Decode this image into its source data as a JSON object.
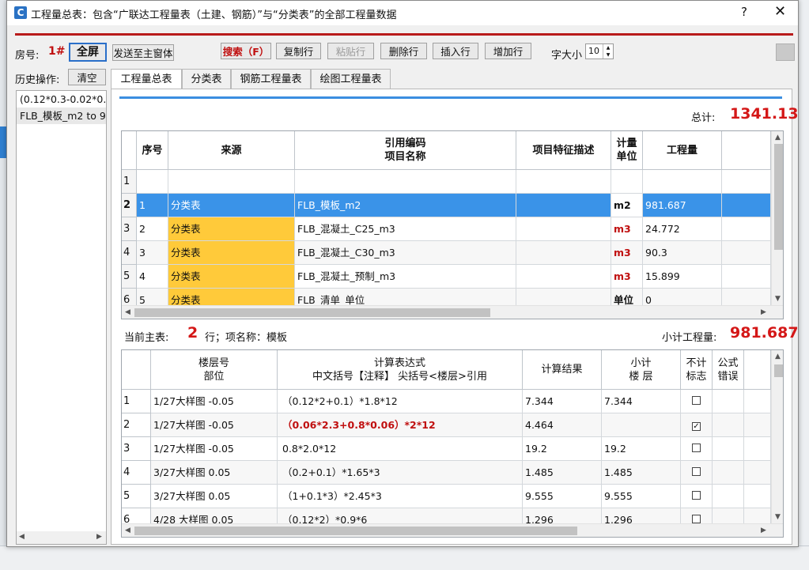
{
  "window": {
    "title": "工程量总表：包含“广联达工程量表（土建、钢筋）”与“分类表”的全部工程量数据",
    "icon": "C",
    "help": "?",
    "close": "✕"
  },
  "toolbar": {
    "room_label": "房号:",
    "room_value": "1#",
    "full_label": "全屏",
    "send_label": "发送至主窗体",
    "search_label": "搜索（F）",
    "copy_row": "复制行",
    "paste_row": "粘贴行",
    "delete_row": "删除行",
    "insert_row": "插入行",
    "add_row": "增加行",
    "font_size_label": "字大小",
    "font_size_value": "10"
  },
  "history": {
    "label": "历史操作:",
    "clear_label": "清空",
    "items": [
      "(0.12*0.3-0.02*0.",
      "FLB_模板_m2 to 9"
    ]
  },
  "tabs": [
    "工程量总表",
    "分类表",
    "钢筋工程量表",
    "绘图工程量表"
  ],
  "summary": {
    "total_label": "总计:",
    "total_value": "1341.13"
  },
  "main_table": {
    "headers": {
      "seq": "序号",
      "source": "来源",
      "code_line1": "引用编码",
      "code_line2": "项目名称",
      "desc": "项目特征描述",
      "unit_line1": "计量",
      "unit_line2": "单位",
      "qty": "工程量"
    },
    "rows": [
      {
        "row": "1",
        "seq": "",
        "source": "",
        "name": "",
        "desc": "",
        "unit": "",
        "qty": ""
      },
      {
        "row": "2",
        "seq": "1",
        "source": "分类表",
        "name": "FLB_模板_m2",
        "desc": "",
        "unit": "m2",
        "qty": "981.687"
      },
      {
        "row": "3",
        "seq": "2",
        "source": "分类表",
        "name": "FLB_混凝土_C25_m3",
        "desc": "",
        "unit": "m3",
        "qty": "24.772"
      },
      {
        "row": "4",
        "seq": "3",
        "source": "分类表",
        "name": "FLB_混凝土_C30_m3",
        "desc": "",
        "unit": "m3",
        "qty": "90.3"
      },
      {
        "row": "5",
        "seq": "4",
        "source": "分类表",
        "name": "FLB_混凝土_预制_m3",
        "desc": "",
        "unit": "m3",
        "qty": "15.899"
      },
      {
        "row": "6",
        "seq": "5",
        "source": "分类表",
        "name": "FLB_清单_单位",
        "desc": "",
        "unit": "单位",
        "qty": "0"
      }
    ]
  },
  "current": {
    "label": "当前主表:",
    "number": "2",
    "name_text": "行；项名称：模板",
    "subtotal_label": "小计工程量:",
    "subtotal_value": "981.687"
  },
  "detail_table": {
    "headers": {
      "floor_line1": "楼层号",
      "floor_line2": "部位",
      "expr_line1": "计算表达式",
      "expr_line2": "中文括号【注释】   尖括号<楼层>引用",
      "result": "计算结果",
      "subtotal_line1": "小计",
      "subtotal_line2": "楼 层",
      "exclude_line1": "不计",
      "exclude_line2": "标志",
      "error_line1": "公式",
      "error_line2": "错误"
    },
    "rows": [
      {
        "row": "1",
        "floor": "1/27大样图 -0.05",
        "expr": "（0.12*2+0.1）*1.8*12",
        "result": "7.344",
        "subtotal": "7.344",
        "excluded": false,
        "highlight": false
      },
      {
        "row": "2",
        "floor": "1/27大样图 -0.05",
        "expr": "（0.06*2.3+0.8*0.06）*2*12",
        "result": "4.464",
        "subtotal": "",
        "excluded": true,
        "highlight": true
      },
      {
        "row": "3",
        "floor": "1/27大样图 -0.05",
        "expr": "0.8*2.0*12",
        "result": "19.2",
        "subtotal": "19.2",
        "excluded": false,
        "highlight": false
      },
      {
        "row": "4",
        "floor": "3/27大样图 0.05",
        "expr": "（0.2+0.1）*1.65*3",
        "result": "1.485",
        "subtotal": "1.485",
        "excluded": false,
        "highlight": false
      },
      {
        "row": "5",
        "floor": "3/27大样图 0.05",
        "expr": "（1+0.1*3）*2.45*3",
        "result": "9.555",
        "subtotal": "9.555",
        "excluded": false,
        "highlight": false
      },
      {
        "row": "6",
        "floor": "4/28 大样图 0.05",
        "expr": "（0.12*2）*0.9*6",
        "result": "1.296",
        "subtotal": "1.296",
        "excluded": false,
        "highlight": false
      }
    ]
  },
  "colors": {
    "accent_red": "#d41717",
    "selection_blue": "#3a93e8",
    "source_orange": "#ffca3a",
    "unit_red": "#c01010"
  }
}
